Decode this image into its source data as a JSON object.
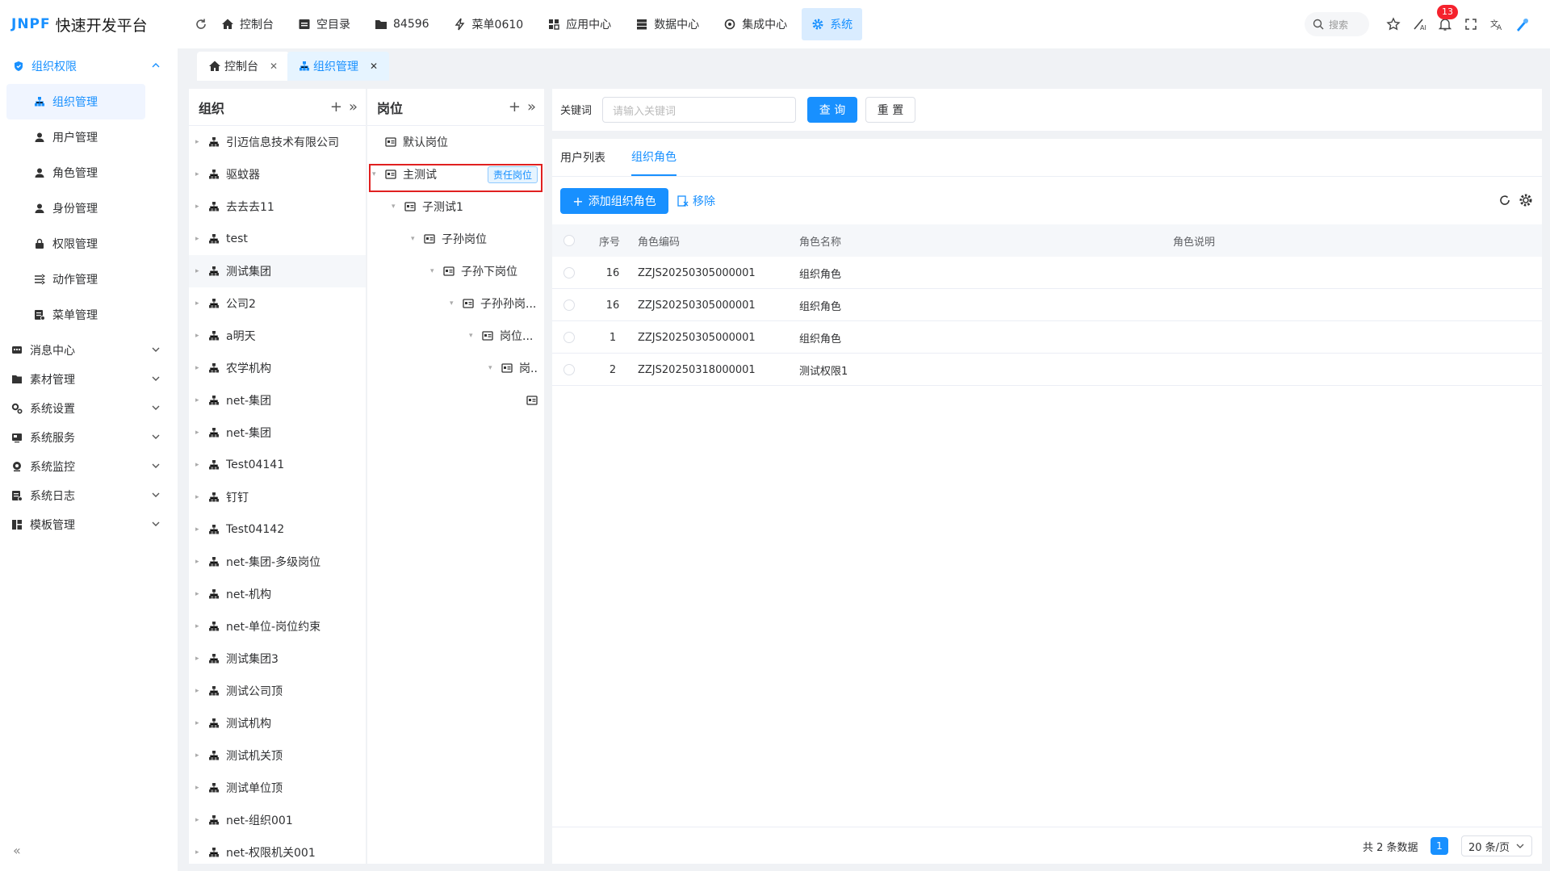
{
  "app": {
    "brand": "JNPF",
    "title": "快速开发平台"
  },
  "topnav": [
    {
      "label": "控制台",
      "icon": "home-icon"
    },
    {
      "label": "空目录",
      "icon": "folder-icon"
    },
    {
      "label": "84596",
      "icon": "folder-icon"
    },
    {
      "label": "菜单0610",
      "icon": "lightning-icon"
    },
    {
      "label": "应用中心",
      "icon": "grid-icon"
    },
    {
      "label": "数据中心",
      "icon": "database-icon"
    },
    {
      "label": "集成中心",
      "icon": "integration-icon"
    },
    {
      "label": "系统",
      "icon": "gear-icon",
      "active": true
    }
  ],
  "header": {
    "search_placeholder": "搜索",
    "notification_count": "13"
  },
  "sidebar": {
    "groups": [
      {
        "label": "组织权限",
        "icon": "shield-icon",
        "expanded": true,
        "items": [
          {
            "label": "组织管理",
            "icon": "org-icon",
            "active": true
          },
          {
            "label": "用户管理",
            "icon": "user-icon"
          },
          {
            "label": "角色管理",
            "icon": "user-icon"
          },
          {
            "label": "身份管理",
            "icon": "user-icon"
          },
          {
            "label": "权限管理",
            "icon": "lock-icon"
          },
          {
            "label": "动作管理",
            "icon": "action-icon"
          },
          {
            "label": "菜单管理",
            "icon": "menu-icon"
          }
        ]
      },
      {
        "label": "消息中心",
        "icon": "message-icon"
      },
      {
        "label": "素材管理",
        "icon": "folder-icon"
      },
      {
        "label": "系统设置",
        "icon": "settings-icon"
      },
      {
        "label": "系统服务",
        "icon": "service-icon"
      },
      {
        "label": "系统监控",
        "icon": "monitor-icon"
      },
      {
        "label": "系统日志",
        "icon": "log-icon"
      },
      {
        "label": "模板管理",
        "icon": "template-icon"
      }
    ]
  },
  "page_tabs": [
    {
      "label": "控制台",
      "icon": "home-icon"
    },
    {
      "label": "组织管理",
      "icon": "org-icon",
      "active": true
    }
  ],
  "org_panel": {
    "title": "组织",
    "items": [
      "引迈信息技术有限公司",
      "驱蚊器",
      "去去去11",
      "test",
      "测试集团",
      "公司2",
      "a明天",
      "农学机构",
      "net-集团",
      "net-集团",
      "Test04141",
      "钉钉",
      "Test04142",
      "net-集团-多级岗位",
      "net-机构",
      "net-单位-岗位约束",
      "测试集团3",
      "测试公司顶",
      "测试机构",
      "测试机关顶",
      "测试单位顶",
      "net-组织001",
      "net-权限机关001"
    ],
    "highlighted_index": 4
  },
  "post_panel": {
    "title": "岗位",
    "items": [
      {
        "label": "默认岗位",
        "level": 0,
        "arrow": false
      },
      {
        "label": "主测试",
        "level": 0,
        "arrow": true,
        "tag": "责任岗位"
      },
      {
        "label": "子测试1",
        "level": 1,
        "arrow": true
      },
      {
        "label": "子孙岗位",
        "level": 2,
        "arrow": true
      },
      {
        "label": "子孙下岗位",
        "level": 3,
        "arrow": true
      },
      {
        "label": "子孙孙岗...",
        "level": 4,
        "arrow": true
      },
      {
        "label": "岗位...",
        "level": 5,
        "arrow": true
      },
      {
        "label": "岗..",
        "level": 6,
        "arrow": true
      },
      {
        "label": "",
        "level": 7,
        "arrow": false
      }
    ]
  },
  "filter": {
    "keyword_label": "关键词",
    "keyword_placeholder": "请输入关键词",
    "query_label": "查 询",
    "reset_label": "重 置"
  },
  "content_tabs": [
    {
      "label": "用户列表"
    },
    {
      "label": "组织角色",
      "active": true
    }
  ],
  "toolbar": {
    "add_label": "添加组织角色",
    "remove_label": "移除"
  },
  "table": {
    "headers": [
      "序号",
      "角色编码",
      "角色名称",
      "角色说明"
    ],
    "rows": [
      {
        "seq": "16",
        "code": "ZZJS20250305000001",
        "name": "组织角色",
        "desc": ""
      },
      {
        "seq": "16",
        "code": "ZZJS20250305000001",
        "name": "组织角色",
        "desc": ""
      },
      {
        "seq": "1",
        "code": "ZZJS20250305000001",
        "name": "组织角色",
        "desc": ""
      },
      {
        "seq": "2",
        "code": "ZZJS20250318000001",
        "name": "测试权限1",
        "desc": ""
      }
    ]
  },
  "pagination": {
    "total_text": "共 2 条数据",
    "current_page": "1",
    "page_size": "20 条/页"
  },
  "colors": {
    "accent": "#1890ff",
    "highlight_border": "#e02020"
  }
}
